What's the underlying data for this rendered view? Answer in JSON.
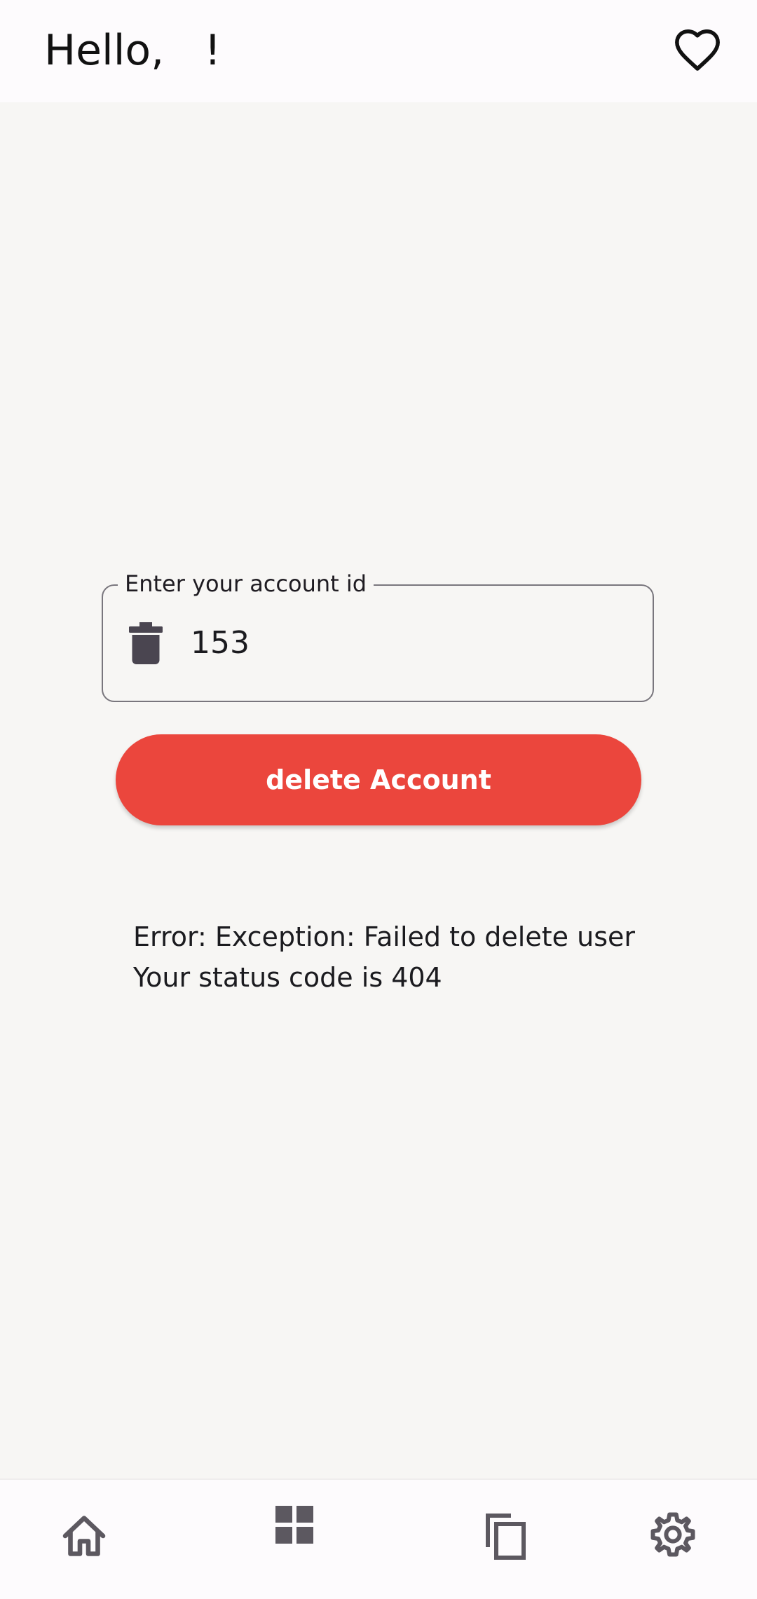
{
  "header": {
    "greeting": "Hello,   !",
    "favorite_icon": "heart-outline-icon"
  },
  "form": {
    "field_label": "Enter your account id",
    "field_value": "153",
    "field_icon": "trash-icon",
    "delete_button_label": "delete Account"
  },
  "result": {
    "error_line": "Error: Exception: Failed to delete user",
    "status_line": "Your status code is 404"
  },
  "bottom_nav": {
    "items": [
      {
        "icon": "home-icon"
      },
      {
        "icon": "dashboard-icon"
      },
      {
        "icon": "copy-icon"
      },
      {
        "icon": "settings-icon"
      }
    ]
  },
  "colors": {
    "accent": "#eb463d",
    "background": "#f7f6f4",
    "bar": "#fdfbfd"
  }
}
